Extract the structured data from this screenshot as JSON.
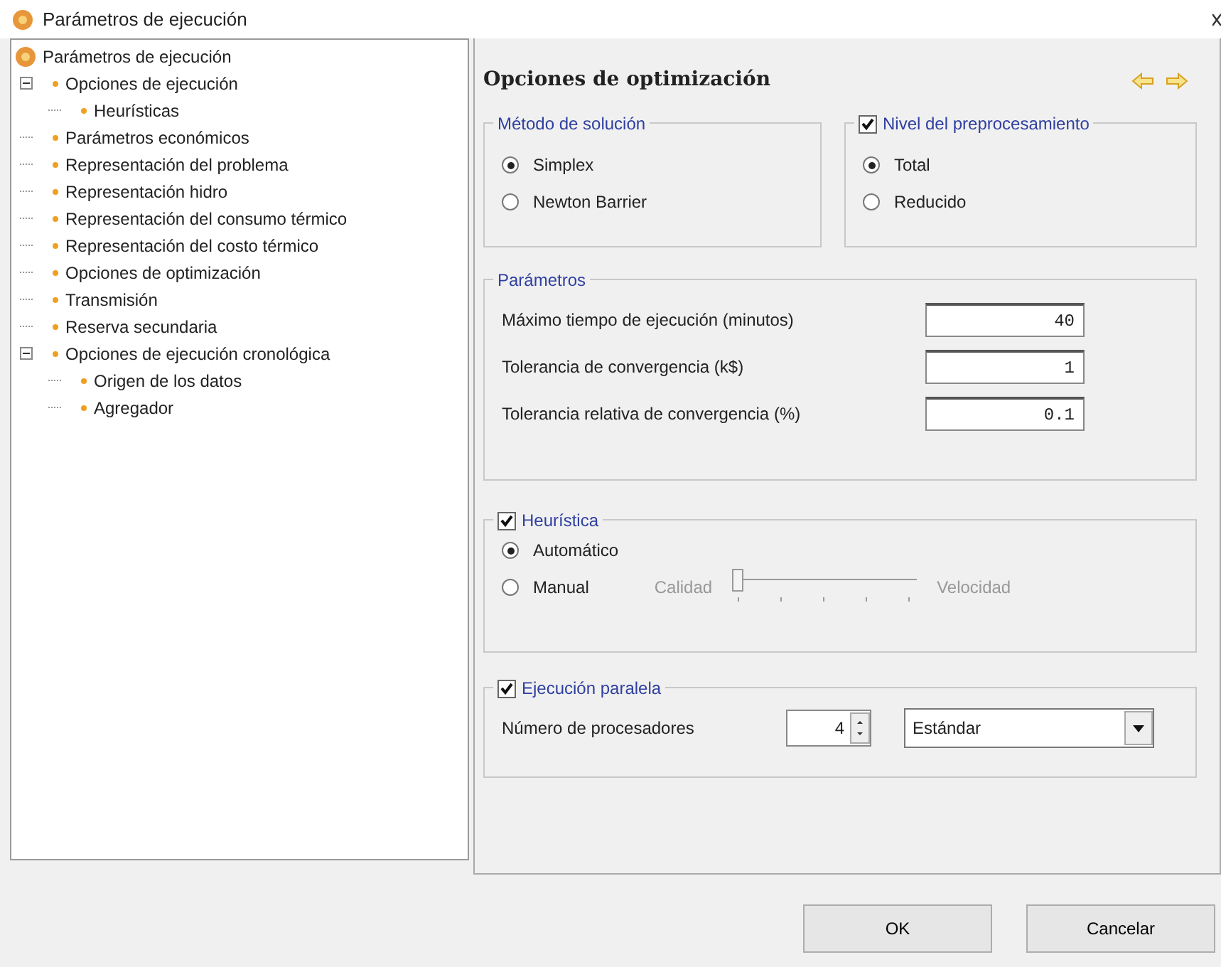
{
  "window": {
    "title": "Parámetros de ejecución"
  },
  "tree": {
    "label": "Parámetros de ejecución",
    "children": [
      {
        "label": "Opciones de ejecución",
        "expanded": true,
        "children": [
          {
            "label": "Heurísticas"
          }
        ]
      },
      {
        "label": "Parámetros económicos"
      },
      {
        "label": "Representación del problema"
      },
      {
        "label": "Representación hidro"
      },
      {
        "label": "Representación del consumo térmico"
      },
      {
        "label": "Representación del costo térmico"
      },
      {
        "label": "Opciones de optimización"
      },
      {
        "label": "Transmisión"
      },
      {
        "label": "Reserva secundaria"
      },
      {
        "label": "Opciones de ejecución cronológica",
        "expanded": true,
        "children": [
          {
            "label": "Origen de los datos"
          },
          {
            "label": "Agregador"
          }
        ]
      }
    ]
  },
  "panel": {
    "title": "Opciones de optimización",
    "metodo": {
      "title": "Método de solución",
      "options": [
        {
          "label": "Simplex",
          "selected": true
        },
        {
          "label": "Newton Barrier",
          "selected": false
        }
      ]
    },
    "nivel": {
      "title": "Nivel del preprocesamiento",
      "checked": true,
      "options": [
        {
          "label": "Total",
          "selected": true
        },
        {
          "label": "Reducido",
          "selected": false
        }
      ]
    },
    "parametros": {
      "title": "Parámetros",
      "fields": [
        {
          "label": "Máximo tiempo de ejecución (minutos)",
          "value": "40"
        },
        {
          "label": "Tolerancia de convergencia (k$)",
          "value": "1"
        },
        {
          "label": "Tolerancia relativa de convergencia (%)",
          "value": "0.1"
        }
      ]
    },
    "heuristica": {
      "title": "Heurística",
      "checked": true,
      "options": [
        {
          "label": "Automático",
          "selected": true
        },
        {
          "label": "Manual",
          "selected": false
        }
      ],
      "slider": {
        "left": "Calidad",
        "right": "Velocidad",
        "level": 0,
        "disabled": true
      }
    },
    "paralela": {
      "title": "Ejecución paralela",
      "checked": true,
      "label": "Número de procesadores",
      "value": "4",
      "mode": "Estándar"
    }
  },
  "buttons": [
    "OK",
    "Cancelar"
  ]
}
